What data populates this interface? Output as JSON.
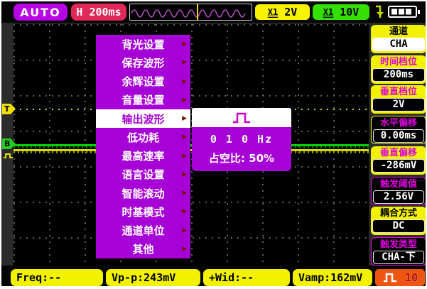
{
  "top_bar": {
    "mode_badge": "AUTO",
    "timebase_badge": "H 200ms",
    "probe_a": {
      "attenuation": "X1",
      "scale": "2V"
    },
    "probe_b": {
      "attenuation": "X1",
      "scale": "10V"
    }
  },
  "menu": {
    "items": [
      "背光设置",
      "保存波形",
      "余辉设置",
      "音量设置",
      "输出波形",
      "低功耗",
      "最高速率",
      "语言设置",
      "智能滚动",
      "时基模式",
      "通道单位",
      "其他"
    ],
    "selected": "输出波形",
    "arrow_glyph": "▶",
    "submenu": {
      "wave_type_icon": "square-wave-icon",
      "frequency": "0 1 0 Hz",
      "duty_label": "占空比:",
      "duty_value": "50%"
    }
  },
  "sidebar": {
    "items": [
      {
        "title": "通道",
        "value": "CHA"
      },
      {
        "title": "时间档位",
        "value": "200ms"
      },
      {
        "title": "垂直档位",
        "value": "2V"
      },
      {
        "title": "水平偏移",
        "value": "0.00ms"
      },
      {
        "title": "垂直偏移",
        "value": "-286mV"
      },
      {
        "title": "触发阈值",
        "value": "2.56V"
      },
      {
        "title": "耦合方式",
        "value": "DC"
      },
      {
        "title": "触发类型",
        "value": "CHA-下"
      }
    ]
  },
  "plot": {
    "trigger_marker": "T",
    "channel_marker": "B"
  },
  "bottom_bar": {
    "measurements": [
      {
        "label": "Freq:",
        "value": " --"
      },
      {
        "label": "Vp-p:",
        "value": "243mV"
      },
      {
        "label": "+Wid:",
        "value": " --"
      },
      {
        "label": "Vamp:",
        "value": "162mV"
      }
    ],
    "wave_badge_count": "10"
  },
  "colors": {
    "menu_purple": "#a602d8",
    "sidebar_yellow": "#f2f200",
    "mode_magenta": "#b803e6",
    "timebase_crimson": "#e22858",
    "probe_yellow": "#f8f400",
    "probe_green": "#33e000",
    "badge_orange": "#ee5511",
    "trace_green": "#00d000",
    "trace_yellow": "#d8d800",
    "magenta_text": "#e000e0"
  }
}
